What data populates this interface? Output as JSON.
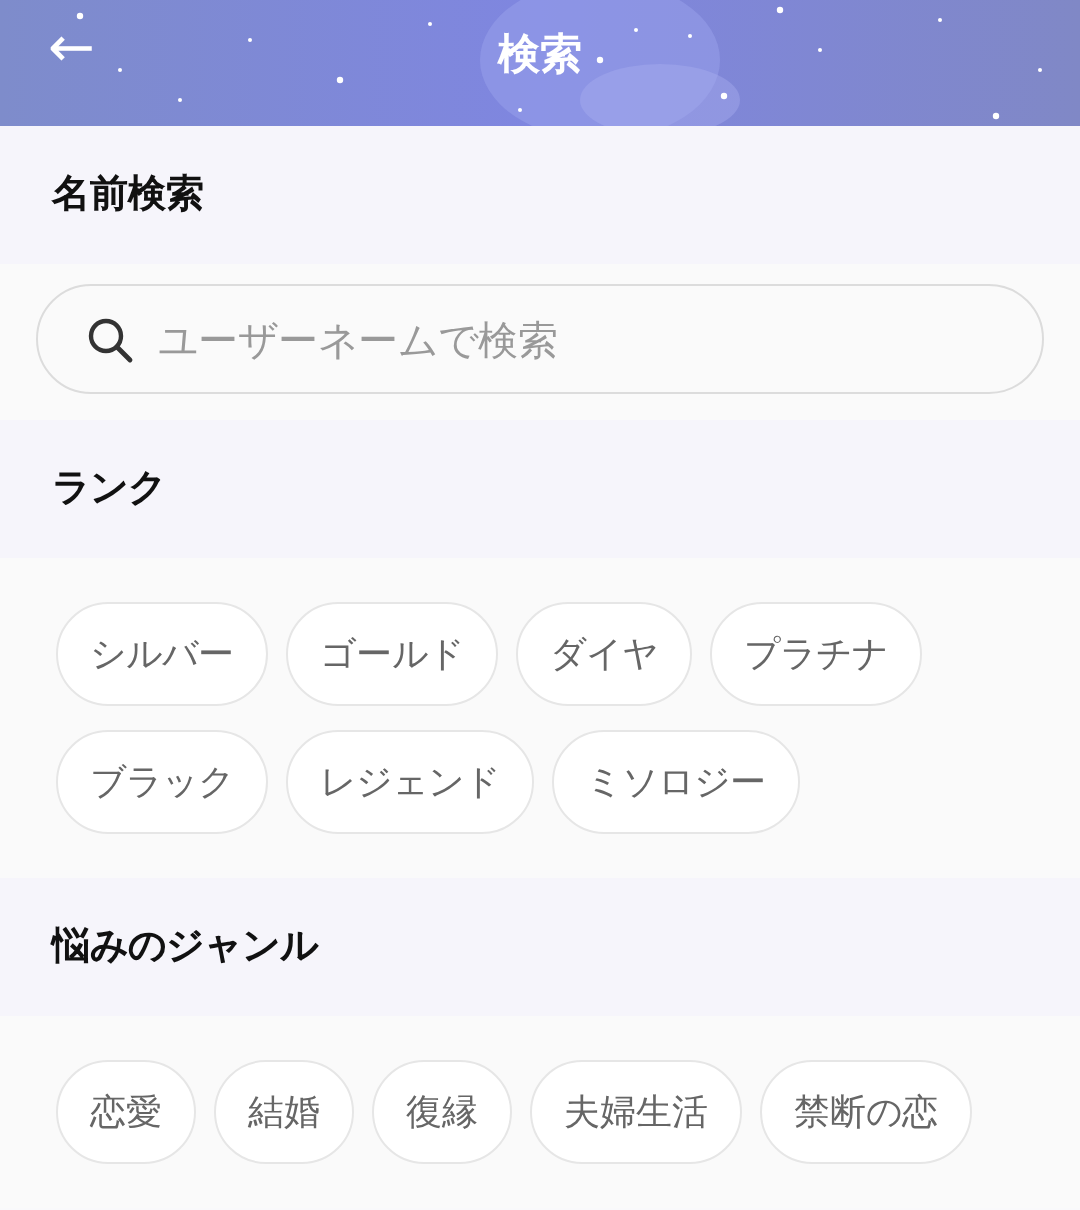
{
  "header": {
    "back": "←",
    "title": "検索"
  },
  "sections": [
    {
      "kind": "search",
      "heading": "名前検索",
      "placeholder": "ユーザーネームで検索"
    },
    {
      "kind": "chips",
      "heading": "ランク",
      "chips": [
        {
          "label": "シルバー",
          "selected": false
        },
        {
          "label": "ゴールド",
          "selected": false
        },
        {
          "label": "ダイヤ",
          "selected": false
        },
        {
          "label": "プラチナ",
          "selected": false
        },
        {
          "label": "ブラック",
          "selected": false
        },
        {
          "label": "レジェンド",
          "selected": false
        },
        {
          "label": "ミソロジー",
          "selected": false
        }
      ]
    },
    {
      "kind": "chips",
      "heading": "悩みのジャンル",
      "chips": [
        {
          "label": "恋愛",
          "selected": false
        },
        {
          "label": "結婚",
          "selected": false
        },
        {
          "label": "復縁",
          "selected": false
        },
        {
          "label": "夫婦生活",
          "selected": false
        },
        {
          "label": "禁断の恋",
          "selected": false
        }
      ]
    }
  ]
}
